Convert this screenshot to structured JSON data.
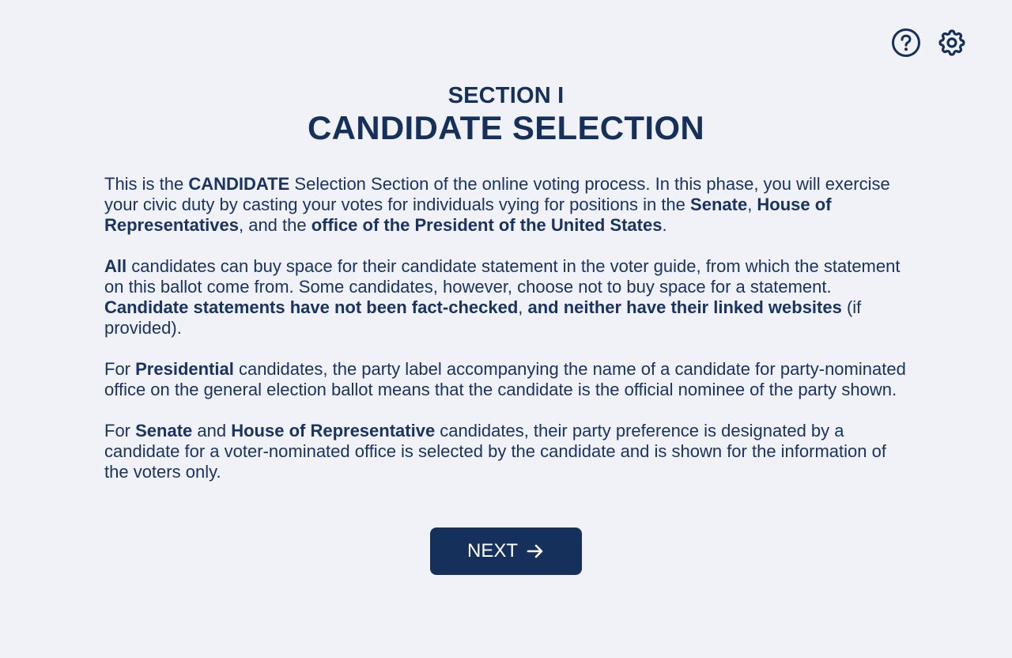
{
  "header": {
    "section_label": "SECTION I",
    "section_title": "CANDIDATE SELECTION"
  },
  "toolbar": {
    "help_icon": "question-circle-icon",
    "settings_icon": "gear-icon"
  },
  "paragraphs": {
    "p1": {
      "t1": "This is the ",
      "b1": "CANDIDATE",
      "t2": " Selection Section of the online voting process. In this phase, you will exercise your civic duty by casting your votes for individuals vying for positions in the ",
      "b2": "Senate",
      "t3": ", ",
      "b3": "House of Representatives",
      "t4": ", and the ",
      "b4": "office of the President of the United States",
      "t5": "."
    },
    "p2": {
      "b1": "All",
      "t1": " candidates can buy space for their candidate statement in the voter guide, from which the statement on this ballot come from. Some candidates, however, choose not to buy space for a statement. ",
      "b2": "Candidate statements have not been fact-checked",
      "t2": ", ",
      "b3": "and neither have their linked websites",
      "t3": " (if provided)."
    },
    "p3": {
      "t1": "For ",
      "b1": "Presidential",
      "t2": " candidates, the party label accompanying the name of a candidate for party-nominated office on the general election ballot means that the candidate is the official nominee of the party shown."
    },
    "p4": {
      "t1": "For ",
      "b1": "Senate",
      "t2": " and ",
      "b2": "House of Representative",
      "t3": " candidates, their party preference is designated by a candidate for a voter-nominated office is selected by the candidate and is shown for the information of the voters only."
    }
  },
  "next_button": {
    "label": "NEXT",
    "icon": "arrow-right-icon"
  },
  "colors": {
    "background": "#f0f2f8",
    "primary": "#16305c",
    "button_text": "#ffffff"
  }
}
